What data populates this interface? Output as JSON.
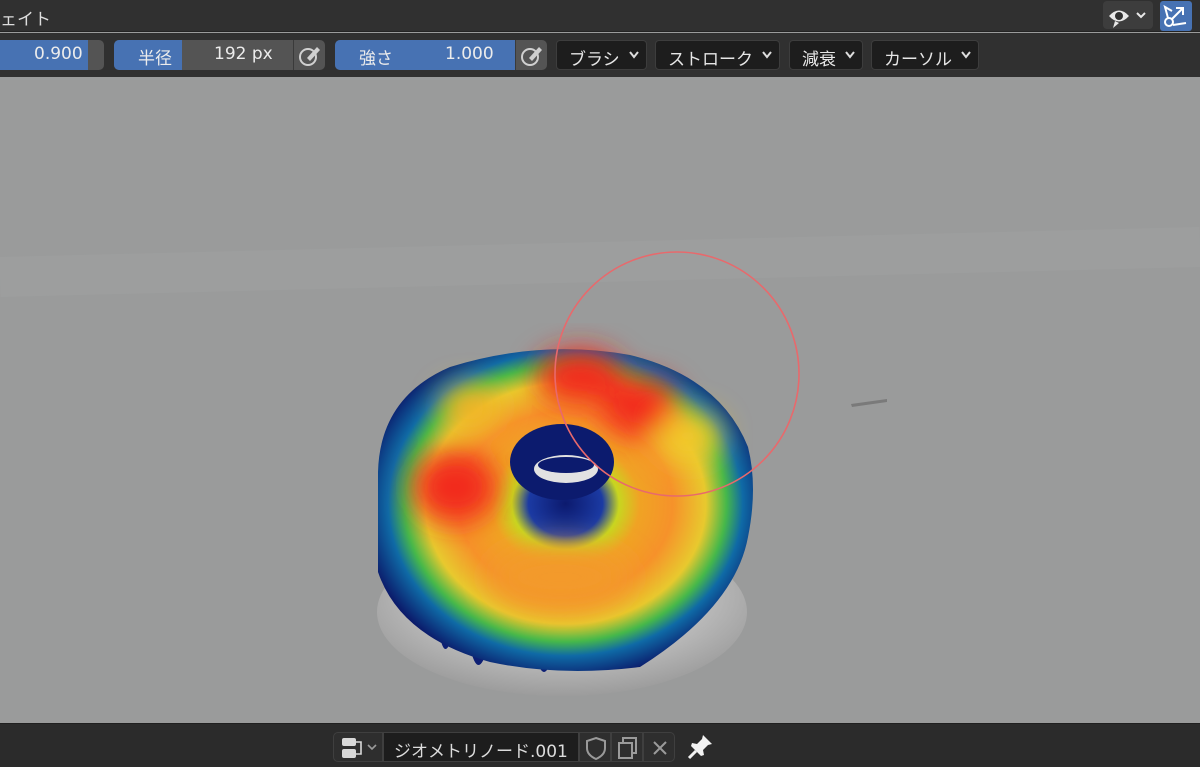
{
  "header": {
    "title": "ェイト",
    "visibility_icon": "eye-icon",
    "gizmo_icon": "gizmo-icon"
  },
  "toolbar": {
    "weight": {
      "value": "0.900",
      "fill_fraction": 1.0
    },
    "radius": {
      "label": "半径",
      "value": "192 px",
      "fill_fraction": 0.38
    },
    "strength": {
      "label": "強さ",
      "value": "1.000",
      "fill_fraction": 1.0
    },
    "menus": [
      {
        "label": "ブラシ"
      },
      {
        "label": "ストローク"
      },
      {
        "label": "減衰"
      },
      {
        "label": "カーソル"
      }
    ]
  },
  "footer": {
    "datablock_name": "ジオメトリノード.001",
    "icons": [
      "shield-icon",
      "duplicate-icon",
      "close-icon",
      "pin-icon"
    ]
  },
  "colors": {
    "accent": "#4772b3",
    "header_bg": "#303030",
    "viewport_bg": "#9a9b9b",
    "brush_cursor": "#e8696c"
  }
}
